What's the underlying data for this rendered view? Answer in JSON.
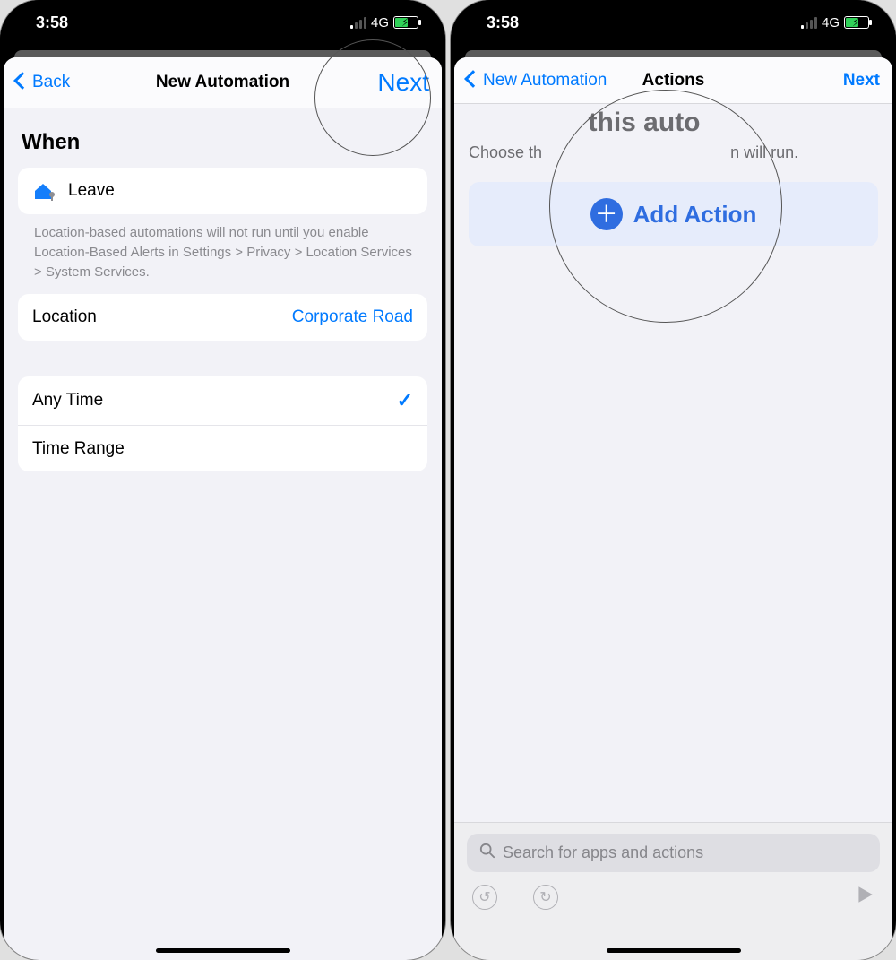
{
  "status": {
    "time": "3:58",
    "network": "4G"
  },
  "left": {
    "nav": {
      "back": "Back",
      "title": "New Automation",
      "next": "Next"
    },
    "section_label": "When",
    "trigger": {
      "label": "Leave"
    },
    "footnote": "Location-based automations will not run until you enable Location-Based Alerts in Settings > Privacy > Location Services > System Services.",
    "location": {
      "label": "Location",
      "value": "Corporate Road"
    },
    "time_options": {
      "any": "Any Time",
      "range": "Time Range"
    }
  },
  "right": {
    "nav": {
      "back": "New Automation",
      "title": "Actions",
      "next": "Next"
    },
    "big_hint_partial": "this auto",
    "sub_hint_prefix": "Choose th",
    "sub_hint_suffix": "n will run.",
    "add_action": "Add Action",
    "search_placeholder": "Search for apps and actions"
  }
}
